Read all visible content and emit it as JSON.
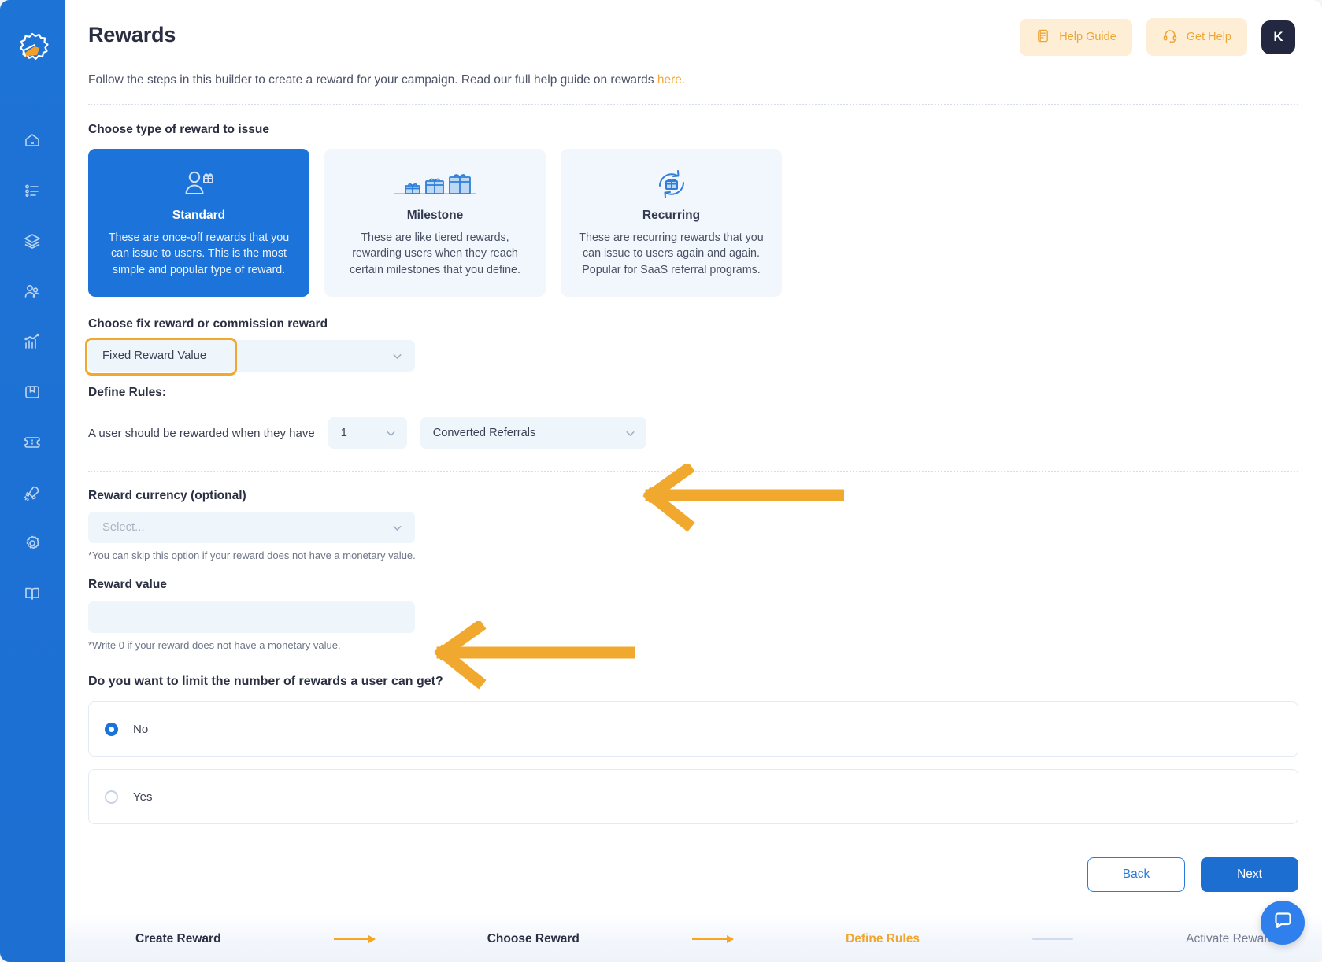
{
  "sidebar": {
    "logo_name": "megaphone-logo",
    "items": [
      {
        "icon": "home-icon",
        "name": "sidebar-item-home"
      },
      {
        "icon": "list-icon",
        "name": "sidebar-item-campaigns"
      },
      {
        "icon": "layers-icon",
        "name": "sidebar-item-layers"
      },
      {
        "icon": "users-icon",
        "name": "sidebar-item-users"
      },
      {
        "icon": "analytics-icon",
        "name": "sidebar-item-analytics"
      },
      {
        "icon": "archive-icon",
        "name": "sidebar-item-archive"
      },
      {
        "icon": "ticket-icon",
        "name": "sidebar-item-rewards"
      },
      {
        "icon": "rocket-icon",
        "name": "sidebar-item-launch"
      },
      {
        "icon": "gear-icon",
        "name": "sidebar-item-settings"
      },
      {
        "icon": "book-icon",
        "name": "sidebar-item-docs"
      }
    ]
  },
  "header": {
    "title": "Rewards",
    "help_guide_label": "Help Guide",
    "get_help_label": "Get Help",
    "avatar_initial": "K"
  },
  "intro": {
    "text": "Follow the steps in this builder to create a reward for your campaign. Read our full help guide on rewards ",
    "link_text": "here.",
    "link_color": "#f0a93a"
  },
  "reward_type": {
    "label": "Choose type of reward to issue",
    "options": [
      {
        "title": "Standard",
        "description": "These are once-off rewards that you can issue to users. This is the most simple and popular type of reward.",
        "icon": "person-gift-icon",
        "selected": true
      },
      {
        "title": "Milestone",
        "description": "These are like tiered rewards, rewarding users when they reach certain milestones that you define.",
        "icon": "three-gifts-icon",
        "selected": false
      },
      {
        "title": "Recurring",
        "description": "These are recurring rewards that you can issue to users again and again. Popular for SaaS referral programs.",
        "icon": "gift-refresh-icon",
        "selected": false
      }
    ]
  },
  "reward_mode": {
    "label": "Choose fix reward or commission reward",
    "selected_value": "Fixed Reward Value",
    "highlighted": true,
    "highlight_color": "#f0a92e"
  },
  "rules": {
    "label": "Define Rules:",
    "sentence": "A user should be rewarded when they have",
    "count_value": "1",
    "event_value": "Converted Referrals"
  },
  "currency": {
    "label": "Reward currency (optional)",
    "placeholder": "Select...",
    "value": "",
    "hint": "*You can skip this option if your reward does not have a monetary value."
  },
  "reward_value": {
    "label": "Reward value",
    "value": "",
    "placeholder": "",
    "hint": "*Write 0 if your reward does not have a monetary value."
  },
  "limit_question": {
    "label": "Do you want to limit the number of rewards a user can get?",
    "options": [
      {
        "label": "No",
        "selected": true
      },
      {
        "label": "Yes",
        "selected": false
      }
    ]
  },
  "nav": {
    "back_label": "Back",
    "next_label": "Next"
  },
  "stepper": {
    "steps": [
      {
        "label": "Create Reward",
        "state": "done"
      },
      {
        "label": "Choose Reward",
        "state": "done"
      },
      {
        "label": "Define Rules",
        "state": "active"
      },
      {
        "label": "Activate Reward",
        "state": "todo"
      }
    ]
  },
  "chat": {
    "icon": "chat-icon"
  },
  "annotations": {
    "arrow_color": "#f0a92e",
    "arrows": [
      {
        "name": "annotation-arrow-rules",
        "points_to": "Converted Referrals"
      },
      {
        "name": "annotation-arrow-reward-value",
        "points_to": "Reward value"
      }
    ]
  }
}
